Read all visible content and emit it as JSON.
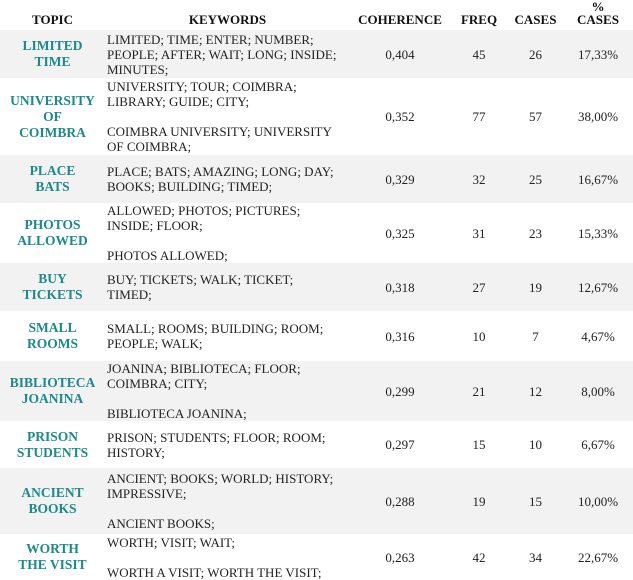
{
  "headers": {
    "topic": "TOPIC",
    "keywords": "KEYWORDS",
    "coherence": "COHERENCE",
    "freq": "FREQ",
    "cases": "CASES",
    "pct_cases_line1": "%",
    "pct_cases_line2": "CASES"
  },
  "rows": [
    {
      "topic_lines": [
        "LIMITED",
        "TIME"
      ],
      "keywords": [
        "LIMITED; TIME; ENTER; NUMBER;",
        "PEOPLE; AFTER; WAIT; LONG; INSIDE;",
        "MINUTES;"
      ],
      "bigrams": [],
      "coherence": "0,404",
      "freq": "45",
      "cases": "26",
      "pct_cases": "17,33%"
    },
    {
      "topic_lines": [
        "UNIVERSITY",
        "OF",
        "COIMBRA"
      ],
      "keywords": [
        "UNIVERSITY; TOUR; COIMBRA;",
        "LIBRARY; GUIDE; CITY;"
      ],
      "bigrams": [
        "COIMBRA UNIVERSITY; UNIVERSITY",
        "OF COIMBRA;"
      ],
      "coherence": "0,352",
      "freq": "77",
      "cases": "57",
      "pct_cases": "38,00%"
    },
    {
      "topic_lines": [
        "PLACE",
        "BATS"
      ],
      "keywords": [
        "PLACE; BATS; AMAZING; LONG; DAY;",
        "BOOKS; BUILDING; TIMED;"
      ],
      "bigrams": [],
      "coherence": "0,329",
      "freq": "32",
      "cases": "25",
      "pct_cases": "16,67%"
    },
    {
      "topic_lines": [
        "PHOTOS",
        "ALLOWED"
      ],
      "keywords": [
        "ALLOWED; PHOTOS; PICTURES;",
        "INSIDE; FLOOR;"
      ],
      "bigrams": [
        "PHOTOS ALLOWED;"
      ],
      "coherence": "0,325",
      "freq": "31",
      "cases": "23",
      "pct_cases": "15,33%"
    },
    {
      "topic_lines": [
        "BUY",
        "TICKETS"
      ],
      "keywords": [
        "BUY; TICKETS; WALK; TICKET;",
        "TIMED;"
      ],
      "bigrams": [],
      "coherence": "0,318",
      "freq": "27",
      "cases": "19",
      "pct_cases": "12,67%"
    },
    {
      "topic_lines": [
        "SMALL",
        "ROOMS"
      ],
      "keywords": [
        "SMALL; ROOMS; BUILDING; ROOM;",
        "PEOPLE; WALK;"
      ],
      "bigrams": [],
      "coherence": "0,316",
      "freq": "10",
      "cases": "7",
      "pct_cases": "4,67%"
    },
    {
      "topic_lines": [
        "BIBLIOTECA",
        "JOANINA"
      ],
      "keywords": [
        "JOANINA; BIBLIOTECA; FLOOR;",
        "COIMBRA; CITY;"
      ],
      "bigrams": [
        "BIBLIOTECA JOANINA;"
      ],
      "coherence": "0,299",
      "freq": "21",
      "cases": "12",
      "pct_cases": "8,00%"
    },
    {
      "topic_lines": [
        "PRISON",
        "STUDENTS"
      ],
      "keywords": [
        "PRISON; STUDENTS; FLOOR; ROOM;",
        "HISTORY;"
      ],
      "bigrams": [],
      "coherence": "0,297",
      "freq": "15",
      "cases": "10",
      "pct_cases": "6,67%"
    },
    {
      "topic_lines": [
        "ANCIENT",
        "BOOKS"
      ],
      "keywords": [
        "ANCIENT; BOOKS; WORLD; HISTORY;",
        "IMPRESSIVE;"
      ],
      "bigrams": [
        "ANCIENT BOOKS;"
      ],
      "coherence": "0,288",
      "freq": "19",
      "cases": "15",
      "pct_cases": "10,00%"
    },
    {
      "topic_lines": [
        "WORTH",
        "THE VISIT"
      ],
      "keywords": [
        "WORTH; VISIT; WAIT;"
      ],
      "bigrams": [
        "WORTH A VISIT; WORTH THE VISIT;"
      ],
      "coherence": "0,263",
      "freq": "42",
      "cases": "34",
      "pct_cases": "22,67%"
    }
  ],
  "colors": {
    "topic_text": "#1a8a8a",
    "band_gray": "#f2f2f2",
    "band_white": "#ffffff"
  }
}
